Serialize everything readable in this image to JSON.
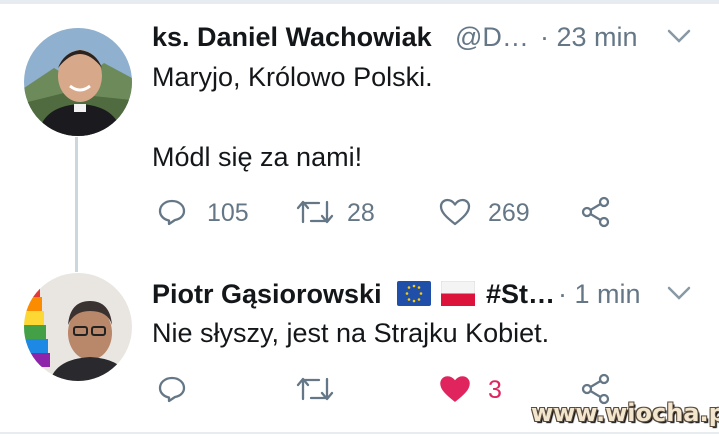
{
  "tweets": [
    {
      "name": "ks. Daniel Wachowiak",
      "handle": "@D…",
      "time": "· 23 min",
      "lines": [
        "Maryjo, Królowo Polski.",
        "Módl się za nami!"
      ],
      "actions": {
        "reply": "105",
        "retweet": "28",
        "like": "269"
      }
    },
    {
      "name": "Piotr Gąsiorowski",
      "handle": "#St…",
      "time": "· 1 min",
      "lines": [
        "Nie słyszy, jest na Strajku Kobiet."
      ],
      "actions": {
        "reply": "",
        "retweet": "",
        "like": "3"
      }
    }
  ],
  "icons": {
    "reply": "reply-icon",
    "retweet": "retweet-icon",
    "like": "heart-icon",
    "share": "share-icon",
    "menu": "chevron-down-icon",
    "flags": [
      "eu-flag-icon",
      "poland-flag-icon"
    ]
  },
  "colors": {
    "secondary": "#657786",
    "like_active": "#e0245e"
  },
  "watermark": "www.wiocha.pl"
}
